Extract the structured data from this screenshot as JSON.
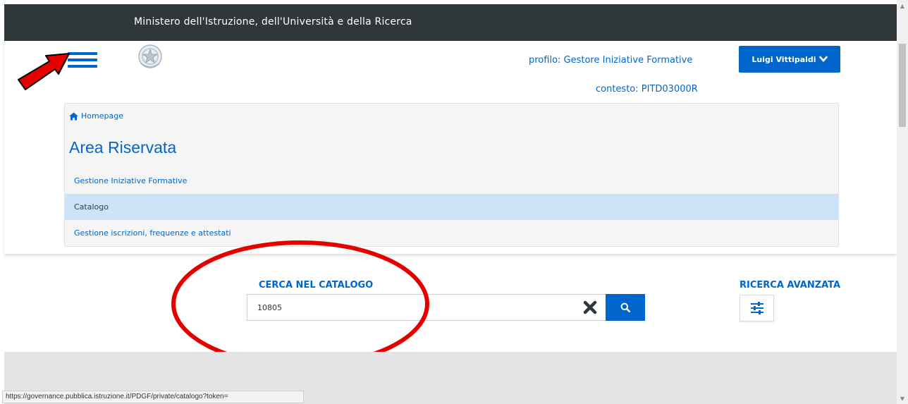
{
  "top_bar": {
    "ministry": "Ministero dell'Istruzione, dell'Università e della Ricerca"
  },
  "header": {
    "profile": "profilo: Gestore Iniziative Formative",
    "context": "contesto: PITD03000R",
    "user_name": "Luigi Vittipaldi"
  },
  "breadcrumb": {
    "home": "Homepage"
  },
  "area": {
    "title": "Area Riservata",
    "items": [
      {
        "label": "Gestione Iniziative Formative",
        "active": false
      },
      {
        "label": "Catalogo",
        "active": true
      },
      {
        "label": "Gestione iscrizioni, frequenze e attestati",
        "active": false
      }
    ]
  },
  "search": {
    "label": "CERCA NEL CATALOGO",
    "value": "10805",
    "advanced_label": "RICERCA AVANZATA"
  },
  "status_bar": {
    "url": "https://governance.pubblica.istruzione.it/PDGF/private/catalogo?token="
  },
  "icons": {
    "menu": "hamburger-menu-icon",
    "home": "home-icon",
    "user_dropdown": "chevron-down-icon",
    "clear": "close-icon",
    "search": "search-icon",
    "advanced": "sliders-icon"
  },
  "colors": {
    "accent": "#0066cc",
    "top_bar": "#30373b",
    "active_item": "#cde3f7",
    "annotation": "#e50000"
  }
}
